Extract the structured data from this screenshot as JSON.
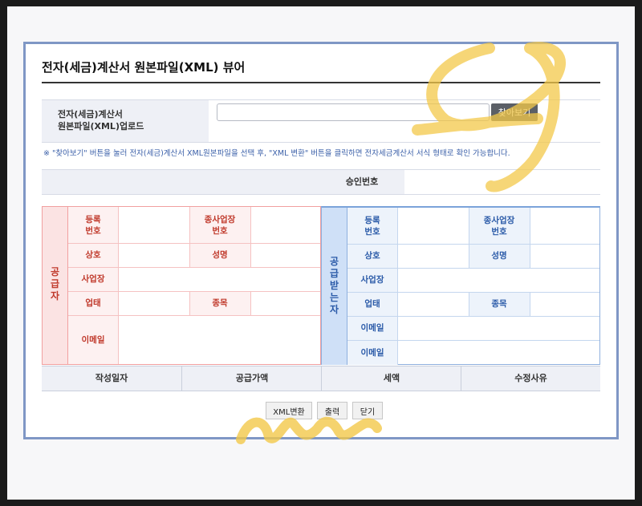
{
  "title": "전자(세금)계산서 원본파일(XML) 뷰어",
  "upload": {
    "label_line1": "전자(세금)계산서",
    "label_line2": "원본파일(XML)업로드",
    "file_value": "",
    "browse_label": "찾아보기"
  },
  "notice": "※ \"찾아보기\" 버튼을 눌러 전자(세금)계산서 XML원본파일을 선택 후, \"XML 변환\" 버튼을 클릭하면 전자세금계산서 서식 형태로 확인 가능합니다.",
  "approval_label": "승인번호",
  "supplier": {
    "side_label": [
      "공",
      "급",
      "자"
    ],
    "reg_no": "등록\n번호",
    "sub_biz_no": "종사업장\n번호",
    "company": "상호",
    "name": "성명",
    "address": "사업장",
    "biz_type": "업태",
    "biz_item": "종목",
    "email": "이메일"
  },
  "buyer": {
    "side_label": [
      "공",
      "급",
      "받",
      "는",
      "자"
    ],
    "reg_no": "등록\n번호",
    "sub_biz_no": "종사업장\n번호",
    "company": "상호",
    "name": "성명",
    "address": "사업장",
    "biz_type": "업태",
    "biz_item": "종목",
    "email1": "이메일",
    "email2": "이메일"
  },
  "footer": {
    "date": "작성일자",
    "supply_amount": "공급가액",
    "tax": "세액",
    "reason": "수정사유"
  },
  "buttons": {
    "xml_convert": "XML변환",
    "print": "출력",
    "close": "닫기"
  },
  "colors": {
    "frame": "#7f97c5",
    "supplier": "#c0392b",
    "buyer": "#2a5aa8",
    "highlighter": "#f3c84a"
  }
}
